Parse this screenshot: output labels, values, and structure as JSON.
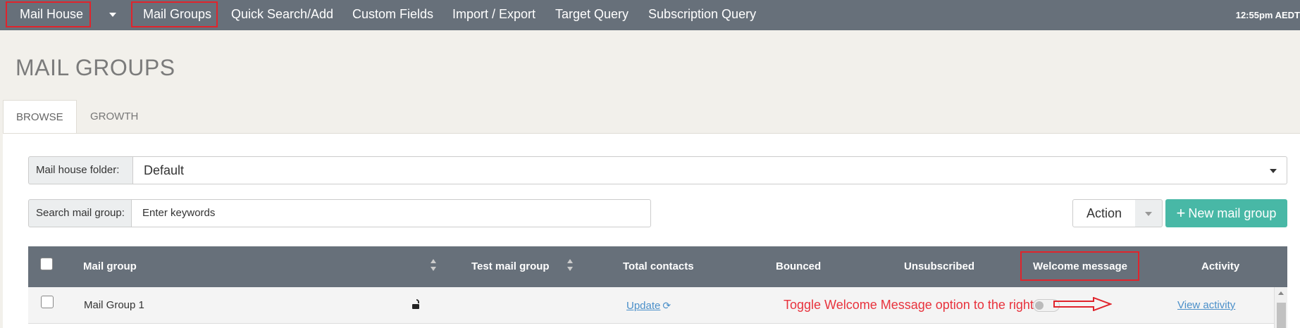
{
  "nav": {
    "mail_house": "Mail House",
    "mail_groups": "Mail Groups",
    "quick_search": "Quick Search/Add",
    "custom_fields": "Custom Fields",
    "import_export": "Import / Export",
    "target_query": "Target Query",
    "subscription_query": "Subscription Query",
    "clock": "12:55pm AEDT"
  },
  "page": {
    "title": "MAIL GROUPS"
  },
  "tabs": [
    {
      "label": "BROWSE",
      "active": true
    },
    {
      "label": "GROWTH",
      "active": false
    }
  ],
  "filters": {
    "folder_label": "Mail house folder:",
    "folder_value": "Default",
    "search_label": "Search mail group:",
    "search_placeholder": "Enter keywords"
  },
  "actions": {
    "action_label": "Action",
    "new_label": "New mail group"
  },
  "table": {
    "columns": [
      "Mail group",
      "Test mail group",
      "Total contacts",
      "Bounced",
      "Unsubscribed",
      "Welcome message",
      "Activity"
    ],
    "rows": [
      {
        "name": "Mail Group 1",
        "total_contacts": "Update",
        "activity": "View activity",
        "welcome_enabled": false
      }
    ]
  },
  "annotation": "Toggle Welcome Message option to the right",
  "colors": {
    "nav_bg": "#67707a",
    "accent": "#48b8a6",
    "highlight": "#e0242c"
  }
}
